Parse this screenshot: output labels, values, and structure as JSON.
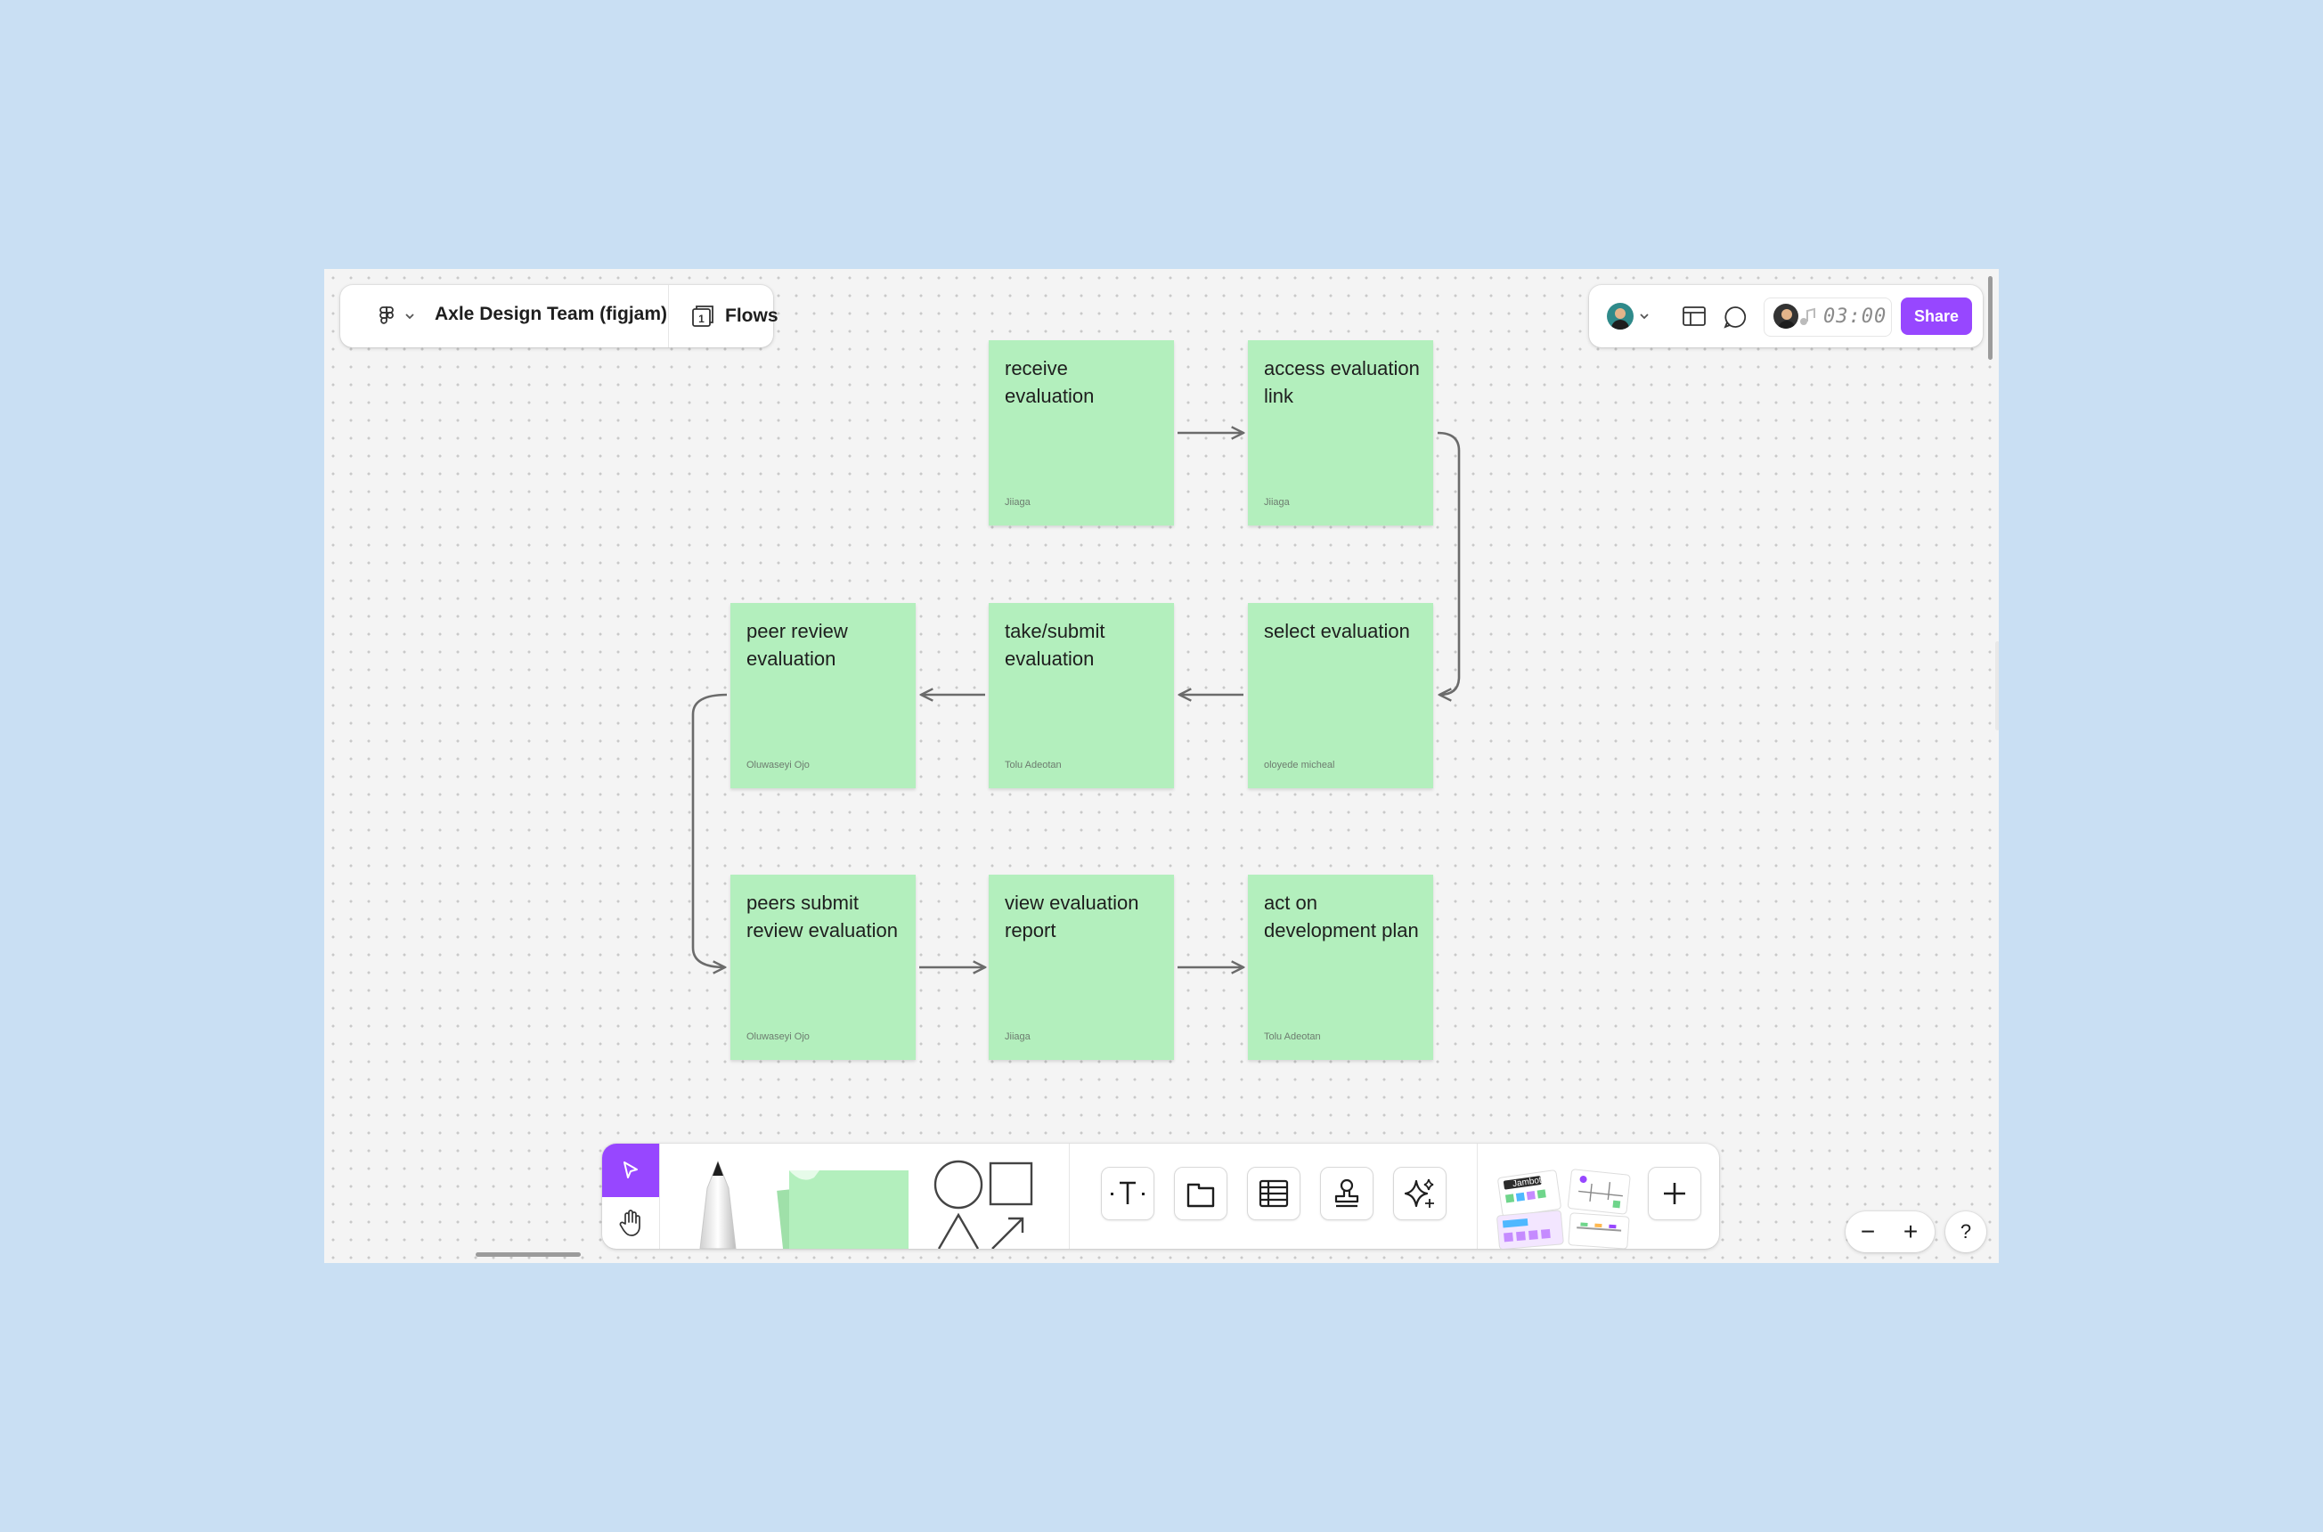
{
  "file": {
    "title": "Axle Design Team (figjam)",
    "pages_count": "1",
    "page_name": "Flows"
  },
  "header_right": {
    "timer": "03:00",
    "share_label": "Share"
  },
  "stickies": [
    {
      "text": "receive evaluation",
      "author": "Jiiaga"
    },
    {
      "text": "access evaluation link",
      "author": "Jiiaga"
    },
    {
      "text": "peer review evaluation",
      "author": "Oluwaseyi Ojo"
    },
    {
      "text": "take/submit evaluation",
      "author": "Tolu Adeotan"
    },
    {
      "text": "select evaluation",
      "author": "oloyede micheal"
    },
    {
      "text": "peers submit review evaluation",
      "author": "Oluwaseyi Ojo"
    },
    {
      "text": "view evaluation report",
      "author": "Jiiaga"
    },
    {
      "text": "act on development plan",
      "author": "Tolu Adeotan"
    }
  ],
  "toolbar": {
    "tools": [
      "select-tool",
      "hand-tool",
      "marker-tool",
      "sticky-note-tool",
      "shapes-tool",
      "text-tool",
      "section-tool",
      "table-tool",
      "stamp-tool",
      "ai-tool",
      "templates-tool",
      "more-tool"
    ],
    "template_label": "Jambot"
  },
  "zoom": {
    "minus": "−",
    "plus": "+",
    "help": "?"
  },
  "colors": {
    "sticky": "#b3efbd",
    "accent": "#9747ff",
    "background": "#c9dff3",
    "canvas": "#f4f4f4"
  }
}
